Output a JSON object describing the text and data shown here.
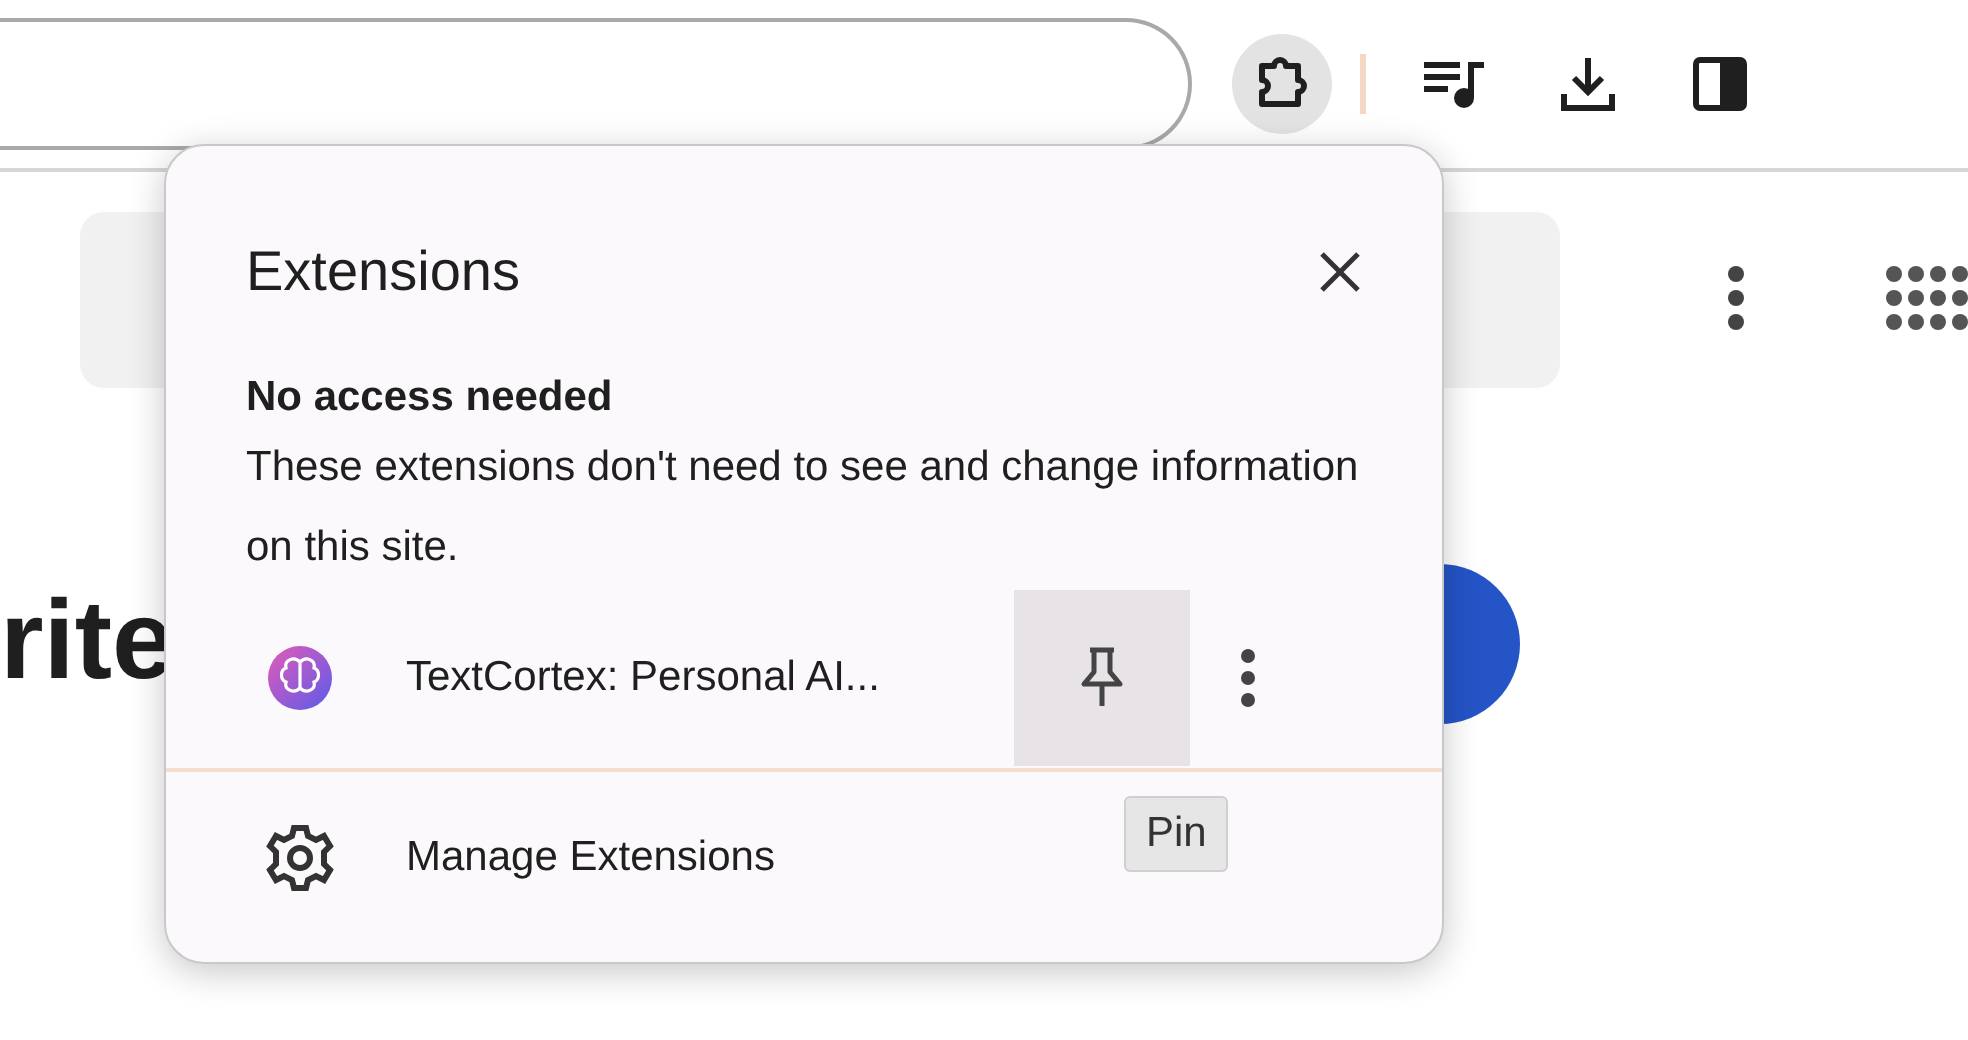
{
  "toolbar": {
    "extensions_button": {
      "selected": true
    }
  },
  "page": {
    "heading": "rite"
  },
  "extensions_popup": {
    "title": "Extensions",
    "section_heading": "No access needed",
    "section_text": "These extensions don't need to see and change information on this site.",
    "extensions": [
      {
        "name": "TextCortex: Personal AI...",
        "pin_hovered": true
      }
    ],
    "tooltip": "Pin",
    "manage_label": "Manage Extensions"
  }
}
